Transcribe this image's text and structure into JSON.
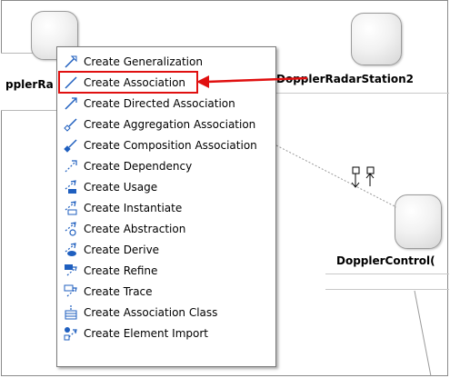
{
  "diagram": {
    "nodes": [
      {
        "label": "pplerRa"
      },
      {
        "label": "DopplerRadarStation2"
      },
      {
        "label": "DopplerControl("
      }
    ]
  },
  "context_menu": {
    "items": [
      {
        "label": "Create Generalization",
        "icon": "generalization-icon"
      },
      {
        "label": "Create Association",
        "icon": "association-icon"
      },
      {
        "label": "Create Directed Association",
        "icon": "directed-association-icon"
      },
      {
        "label": "Create Aggregation Association",
        "icon": "aggregation-association-icon"
      },
      {
        "label": "Create Composition Association",
        "icon": "composition-association-icon"
      },
      {
        "label": "Create Dependency",
        "icon": "dependency-icon"
      },
      {
        "label": "Create Usage",
        "icon": "usage-icon"
      },
      {
        "label": "Create Instantiate",
        "icon": "instantiate-icon"
      },
      {
        "label": "Create Abstraction",
        "icon": "abstraction-icon"
      },
      {
        "label": "Create Derive",
        "icon": "derive-icon"
      },
      {
        "label": "Create Refine",
        "icon": "refine-icon"
      },
      {
        "label": "Create Trace",
        "icon": "trace-icon"
      },
      {
        "label": "Create Association Class",
        "icon": "association-class-icon"
      },
      {
        "label": "Create Element Import",
        "icon": "element-import-icon"
      }
    ],
    "highlighted_index": 1
  },
  "colors": {
    "highlight": "#e01010",
    "icon_blue": "#1f5fbf"
  }
}
